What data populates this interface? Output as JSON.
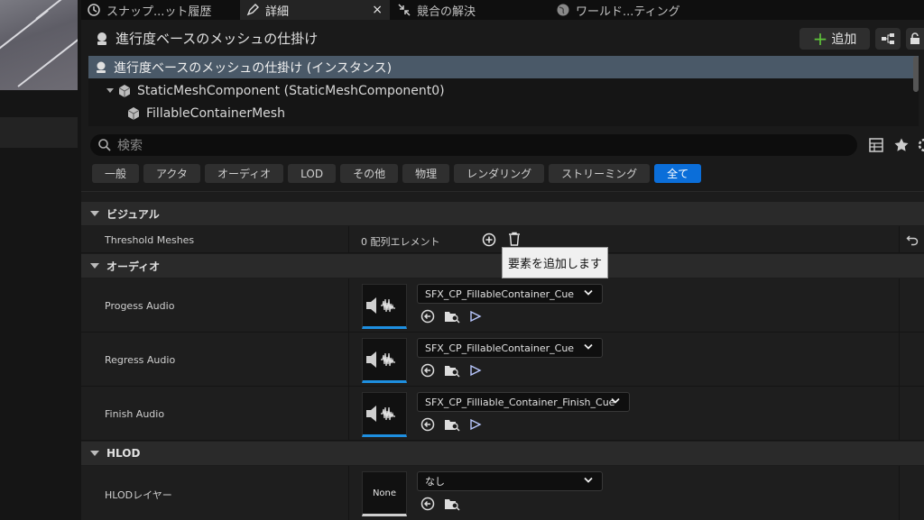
{
  "tabs": [
    {
      "label": "スナップ...ット履歴",
      "icon": "history-icon"
    },
    {
      "label": "詳細",
      "icon": "pencil-icon",
      "active": true
    },
    {
      "label": "競合の解決",
      "icon": "collapse-arrows-icon"
    },
    {
      "label": "ワールド...ティング",
      "icon": "globe-icon"
    }
  ],
  "header": {
    "title": "進行度ベースのメッシュの仕掛け",
    "add_label": "追加"
  },
  "tree": [
    {
      "label": "進行度ベースのメッシュの仕掛け (インスタンス)"
    },
    {
      "label": "StaticMeshComponent (StaticMeshComponent0)"
    },
    {
      "label": "FillableContainerMesh"
    }
  ],
  "search": {
    "placeholder": "検索"
  },
  "filters": [
    "一般",
    "アクタ",
    "オーディオ",
    "LOD",
    "その他",
    "物理",
    "レンダリング",
    "ストリーミング",
    "全て"
  ],
  "sections": {
    "visual": "ビジュアル",
    "audio": "オーディオ",
    "hlod": "HLOD"
  },
  "visual_props": {
    "threshold_label": "Threshold Meshes",
    "threshold_value": "0 配列エレメント"
  },
  "tooltip": "要素を追加します",
  "audio_props": [
    {
      "label": "Progess Audio",
      "value": "SFX_CP_FillableContainer_Cue"
    },
    {
      "label": "Regress Audio",
      "value": "SFX_CP_FillableContainer_Cue"
    },
    {
      "label": "Finish Audio",
      "value": "SFX_CP_Filliable_Container_Finish_Cue"
    }
  ],
  "hlod_props": {
    "label": "HLODレイヤー",
    "thumb": "None",
    "value": "なし"
  },
  "colors": {
    "accent": "#0b6ed9",
    "selection": "#4a5968",
    "add": "#5fc43a"
  }
}
